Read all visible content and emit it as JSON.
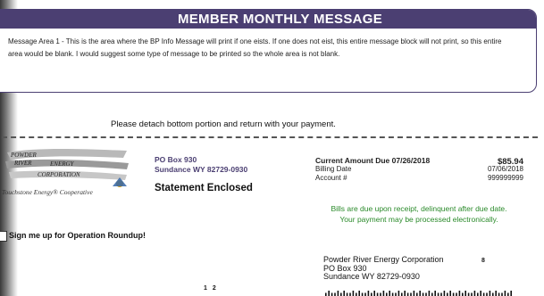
{
  "message": {
    "title": "MEMBER MONTHLY MESSAGE",
    "body": "Message Area 1 - This is the area where the BP Info Message will print if one eists.  If one does not eist, this entire message block will not print, so this entire area would be blank.  I would suggest some type of message to be printed so the whole area is not blank."
  },
  "detach_instruction": "Please detach bottom portion and return with your payment.",
  "logo": {
    "lines": [
      "POWDER",
      "RIVER",
      "ENERGY",
      "CORPORATION"
    ],
    "tagline": "Touchstone Energy® Cooperative"
  },
  "sender": {
    "po_box": "PO Box 930",
    "city_line": "Sundance WY 82729-0930",
    "statement_label": "Statement Enclosed"
  },
  "amounts": {
    "current_due_label": "Current Amount Due 07/26/2018",
    "current_due_value": "$85.94",
    "billing_date_label": "Billing Date",
    "billing_date_value": "07/06/2018",
    "account_label": "Account #",
    "account_value": "999999999"
  },
  "notice": {
    "line1": "Bills are due upon receipt, delinquent after due date.",
    "line2": "Your payment may be processed electronically."
  },
  "roundup_label": "Sign me up for Operation Roundup!",
  "remit": {
    "name": "Powder River Energy Corporation",
    "po_box": "PO Box 930",
    "city_line": "Sundance WY 82729-0930",
    "code": "8"
  },
  "page_marker": "1 2",
  "colors": {
    "brand_purple": "#4b3f72",
    "notice_green": "#2a8a2a"
  }
}
